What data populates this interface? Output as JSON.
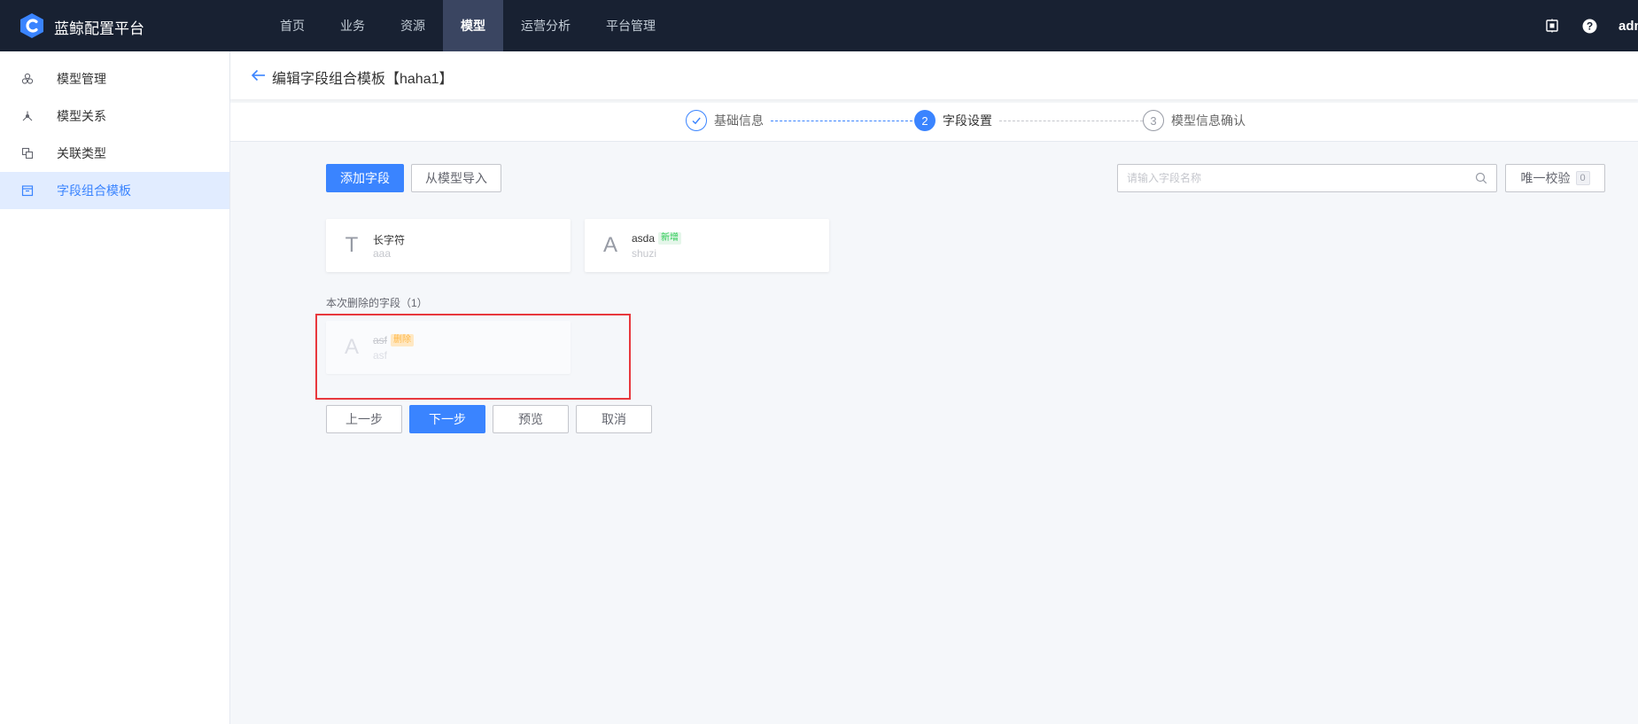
{
  "app": {
    "brand": "蓝鲸配置平台",
    "user": "admin"
  },
  "nav": [
    {
      "label": "首页",
      "active": false
    },
    {
      "label": "业务",
      "active": false
    },
    {
      "label": "资源",
      "active": false
    },
    {
      "label": "模型",
      "active": true
    },
    {
      "label": "运营分析",
      "active": false
    },
    {
      "label": "平台管理",
      "active": false
    }
  ],
  "sidebar": {
    "items": [
      {
        "label": "模型管理",
        "icon": "model-manage-icon",
        "active": false
      },
      {
        "label": "模型关系",
        "icon": "model-relation-icon",
        "active": false
      },
      {
        "label": "关联类型",
        "icon": "association-type-icon",
        "active": false
      },
      {
        "label": "字段组合模板",
        "icon": "field-template-icon",
        "active": true
      }
    ]
  },
  "header": {
    "title": "编辑字段组合模板【haha1】"
  },
  "steps": [
    {
      "number": "1",
      "label": "基础信息",
      "status": "done"
    },
    {
      "number": "2",
      "label": "字段设置",
      "status": "current"
    },
    {
      "number": "3",
      "label": "模型信息确认",
      "status": "todo"
    }
  ],
  "toolbar": {
    "add_field": "添加字段",
    "import_from_model": "从模型导入",
    "search_placeholder": "请输入字段名称",
    "unique_check": "唯一校验",
    "unique_count": "0"
  },
  "fields": [
    {
      "type_glyph": "T",
      "name": "长字符",
      "id": "aaa",
      "tag": ""
    },
    {
      "type_glyph": "A",
      "name": "asda",
      "id": "shuzi",
      "tag": "新增"
    }
  ],
  "deleted_section": {
    "label": "本次删除的字段（1）",
    "fields": [
      {
        "type_glyph": "A",
        "name": "asf",
        "id": "asf",
        "tag": "删除"
      }
    ]
  },
  "footer": {
    "prev": "上一步",
    "next": "下一步",
    "preview": "预览",
    "cancel": "取消"
  },
  "colors": {
    "primary": "#3a84ff",
    "topbar": "#182132",
    "highlight": "#e8383d"
  }
}
